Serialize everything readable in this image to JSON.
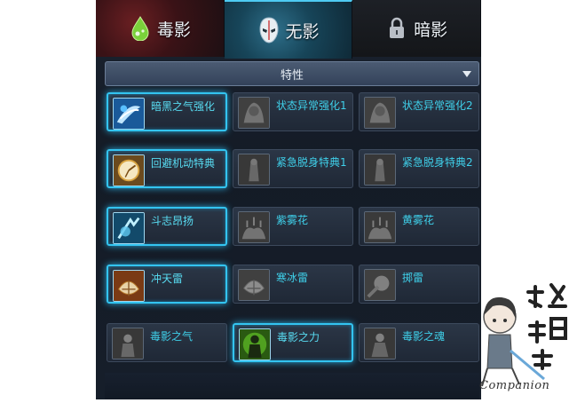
{
  "tabs": [
    {
      "label": "毒影",
      "icon": "poison-drop-icon",
      "active": false
    },
    {
      "label": "无影",
      "icon": "mask-icon",
      "active": true
    },
    {
      "label": "暗影",
      "icon": "lock-icon",
      "active": false
    }
  ],
  "dropdown": {
    "label": "特性",
    "icon": "triangle-down-icon"
  },
  "skills": [
    [
      {
        "name": "暗黑之气强化",
        "active": true,
        "icon": "dark-aura-skill-icon"
      },
      {
        "name": "状态异常强化1",
        "active": false,
        "icon": "status-boost-skill-icon"
      },
      {
        "name": "状态异常强化2",
        "active": false,
        "icon": "status-boost-skill-icon"
      }
    ],
    [
      {
        "name": "回避机动特典",
        "active": true,
        "icon": "evasion-skill-icon"
      },
      {
        "name": "紧急脱身特典1",
        "active": false,
        "icon": "escape-skill-icon"
      },
      {
        "name": "紧急脱身特典2",
        "active": false,
        "icon": "escape-skill-icon"
      }
    ],
    [
      {
        "name": "斗志昂扬",
        "active": true,
        "icon": "fighting-spirit-skill-icon"
      },
      {
        "name": "紫雾花",
        "active": false,
        "icon": "purple-mist-skill-icon"
      },
      {
        "name": "黄雾花",
        "active": false,
        "icon": "yellow-mist-skill-icon"
      }
    ],
    [
      {
        "name": "冲天雷",
        "active": true,
        "icon": "sky-thunder-skill-icon"
      },
      {
        "name": "寒冰雷",
        "active": false,
        "icon": "ice-thunder-skill-icon"
      },
      {
        "name": "掷雷",
        "active": false,
        "icon": "throw-thunder-skill-icon"
      }
    ],
    [
      {
        "name": "毒影之气",
        "active": false,
        "icon": "poison-aura-skill-icon"
      },
      {
        "name": "毒影之力",
        "active": true,
        "icon": "poison-power-skill-icon"
      },
      {
        "name": "毒影之魂",
        "active": false,
        "icon": "poison-soul-skill-icon"
      }
    ]
  ],
  "watermark": {
    "caption": "Companion",
    "logo_text": "攻略組"
  },
  "colors": {
    "active_border": "#33c4f0",
    "skill_name": "#3fd0ea",
    "panel_bg": "#161e2a"
  }
}
